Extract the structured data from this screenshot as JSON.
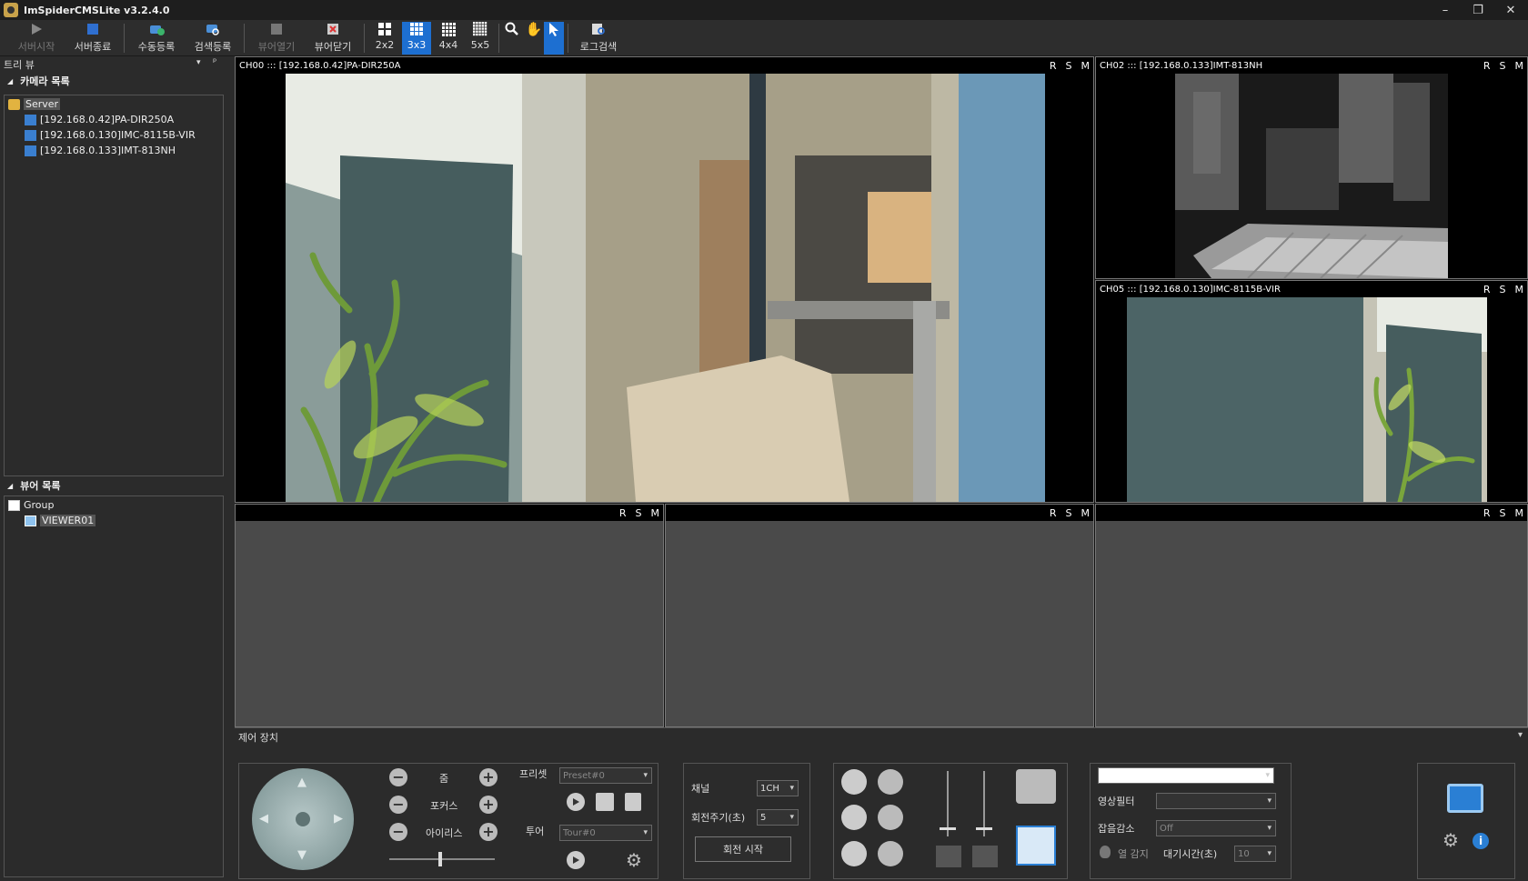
{
  "window": {
    "title": "ImSpiderCMSLite v3.2.4.0",
    "min": "–",
    "restore": "❐",
    "close": "✕"
  },
  "toolbar": {
    "server_start": "서버시작",
    "server_stop": "서버종료",
    "manual_register": "수동등록",
    "search_register": "검색등록",
    "viewer_open": "뷰어열기",
    "viewer_close": "뷰어닫기",
    "grid_2x2": "2x2",
    "grid_3x3": "3x3",
    "grid_4x4": "4x4",
    "grid_5x5": "5x5",
    "log_search": "로그검색"
  },
  "sidebar": {
    "tree_view_label": "트리 뷰",
    "camera_list_label": "카메라 목록",
    "server_node": "Server",
    "cameras": [
      "[192.168.0.42]PA-DIR250A",
      "[192.168.0.130]IMC-8115B-VIR",
      "[192.168.0.133]IMT-813NH"
    ],
    "viewer_list_label": "뷰어 목록",
    "group_node": "Group",
    "viewer_node": "VIEWER01"
  },
  "channels": {
    "ch00": "CH00 ::: [192.168.0.42]PA-DIR250A",
    "ch02": "CH02 ::: [192.168.0.133]IMT-813NH",
    "ch05": "CH05 ::: [192.168.0.130]IMC-8115B-VIR",
    "r": "R",
    "s": "S",
    "m": "M"
  },
  "control": {
    "title": "제어 장치",
    "zoom": "줌",
    "focus": "포커스",
    "iris": "아이리스",
    "preset_label": "프리셋",
    "preset_value": "Preset#0",
    "tour_label": "투어",
    "tour_value": "Tour#0",
    "channel_label": "채널",
    "channel_value": "1CH",
    "rotation_label": "회전주기(초)",
    "rotation_value": "5",
    "rotation_start": "회전 시작",
    "video_filter_label": "영상필터",
    "noise_label": "잡음감소",
    "noise_value": "Off",
    "heat_label": "열 감지",
    "wait_label": "대기시간(초)",
    "wait_value": "10"
  },
  "colors": {
    "accent": "#1d6fd1",
    "info": "#2a7fd4"
  }
}
